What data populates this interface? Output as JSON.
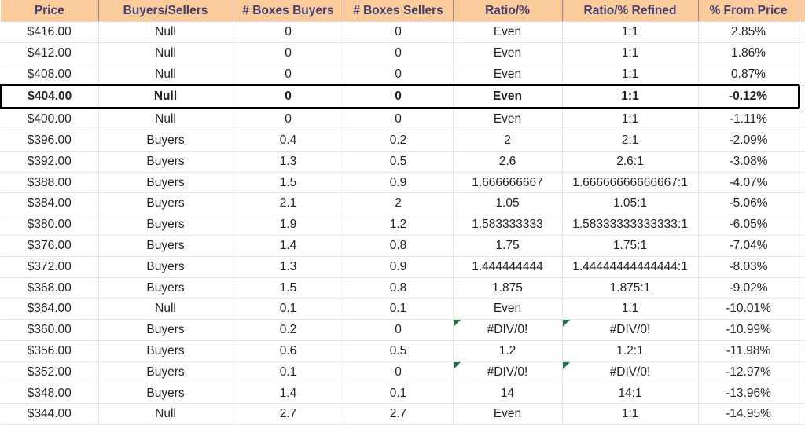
{
  "sheet": {
    "highlighted_row_index": 3,
    "colors": {
      "header_fill": "#FBCB9C",
      "header_text": "#403E6E",
      "null_fill": "#FCE79C",
      "null_text": "#9C6500",
      "buyers_fill": "#C6EFCE",
      "buyers_text": "#1D7A32",
      "grid_line": "#E4E4E4",
      "highlight_border": "#000000",
      "error_flag": "#217346"
    },
    "columns": [
      "Price",
      "Buyers/Sellers",
      "# Boxes Buyers",
      "# Boxes Sellers",
      "Ratio/%",
      "Ratio/% Refined",
      "% From Price"
    ],
    "rows": [
      {
        "price": "$416.00",
        "buyers_sellers": "Null",
        "fill": "null",
        "boxes_buyers": "0",
        "boxes_sellers": "0",
        "ratio": "Even",
        "ratio_refined": "1:1",
        "pct_from_price": "2.85%",
        "ratio_error": false,
        "ratio_refined_error": false
      },
      {
        "price": "$412.00",
        "buyers_sellers": "Null",
        "fill": "null",
        "boxes_buyers": "0",
        "boxes_sellers": "0",
        "ratio": "Even",
        "ratio_refined": "1:1",
        "pct_from_price": "1.86%",
        "ratio_error": false,
        "ratio_refined_error": false
      },
      {
        "price": "$408.00",
        "buyers_sellers": "Null",
        "fill": "null",
        "boxes_buyers": "0",
        "boxes_sellers": "0",
        "ratio": "Even",
        "ratio_refined": "1:1",
        "pct_from_price": "0.87%",
        "ratio_error": false,
        "ratio_refined_error": false
      },
      {
        "price": "$404.00",
        "buyers_sellers": "Null",
        "fill": "null",
        "boxes_buyers": "0",
        "boxes_sellers": "0",
        "ratio": "Even",
        "ratio_refined": "1:1",
        "pct_from_price": "-0.12%",
        "ratio_error": false,
        "ratio_refined_error": false
      },
      {
        "price": "$400.00",
        "buyers_sellers": "Null",
        "fill": "null",
        "boxes_buyers": "0",
        "boxes_sellers": "0",
        "ratio": "Even",
        "ratio_refined": "1:1",
        "pct_from_price": "-1.11%",
        "ratio_error": false,
        "ratio_refined_error": false
      },
      {
        "price": "$396.00",
        "buyers_sellers": "Buyers",
        "fill": "buyers",
        "boxes_buyers": "0.4",
        "boxes_sellers": "0.2",
        "ratio": "2",
        "ratio_refined": "2:1",
        "pct_from_price": "-2.09%",
        "ratio_error": false,
        "ratio_refined_error": false
      },
      {
        "price": "$392.00",
        "buyers_sellers": "Buyers",
        "fill": "buyers",
        "boxes_buyers": "1.3",
        "boxes_sellers": "0.5",
        "ratio": "2.6",
        "ratio_refined": "2.6:1",
        "pct_from_price": "-3.08%",
        "ratio_error": false,
        "ratio_refined_error": false
      },
      {
        "price": "$388.00",
        "buyers_sellers": "Buyers",
        "fill": "buyers",
        "boxes_buyers": "1.5",
        "boxes_sellers": "0.9",
        "ratio": "1.666666667",
        "ratio_refined": "1.66666666666667:1",
        "pct_from_price": "-4.07%",
        "ratio_error": false,
        "ratio_refined_error": false
      },
      {
        "price": "$384.00",
        "buyers_sellers": "Buyers",
        "fill": "buyers",
        "boxes_buyers": "2.1",
        "boxes_sellers": "2",
        "ratio": "1.05",
        "ratio_refined": "1.05:1",
        "pct_from_price": "-5.06%",
        "ratio_error": false,
        "ratio_refined_error": false
      },
      {
        "price": "$380.00",
        "buyers_sellers": "Buyers",
        "fill": "buyers",
        "boxes_buyers": "1.9",
        "boxes_sellers": "1.2",
        "ratio": "1.583333333",
        "ratio_refined": "1.58333333333333:1",
        "pct_from_price": "-6.05%",
        "ratio_error": false,
        "ratio_refined_error": false
      },
      {
        "price": "$376.00",
        "buyers_sellers": "Buyers",
        "fill": "buyers",
        "boxes_buyers": "1.4",
        "boxes_sellers": "0.8",
        "ratio": "1.75",
        "ratio_refined": "1.75:1",
        "pct_from_price": "-7.04%",
        "ratio_error": false,
        "ratio_refined_error": false
      },
      {
        "price": "$372.00",
        "buyers_sellers": "Buyers",
        "fill": "buyers",
        "boxes_buyers": "1.3",
        "boxes_sellers": "0.9",
        "ratio": "1.444444444",
        "ratio_refined": "1.44444444444444:1",
        "pct_from_price": "-8.03%",
        "ratio_error": false,
        "ratio_refined_error": false
      },
      {
        "price": "$368.00",
        "buyers_sellers": "Buyers",
        "fill": "buyers",
        "boxes_buyers": "1.5",
        "boxes_sellers": "0.8",
        "ratio": "1.875",
        "ratio_refined": "1.875:1",
        "pct_from_price": "-9.02%",
        "ratio_error": false,
        "ratio_refined_error": false
      },
      {
        "price": "$364.00",
        "buyers_sellers": "Null",
        "fill": "null",
        "boxes_buyers": "0.1",
        "boxes_sellers": "0.1",
        "ratio": "Even",
        "ratio_refined": "1:1",
        "pct_from_price": "-10.01%",
        "ratio_error": false,
        "ratio_refined_error": false
      },
      {
        "price": "$360.00",
        "buyers_sellers": "Buyers",
        "fill": "buyers",
        "boxes_buyers": "0.2",
        "boxes_sellers": "0",
        "ratio": "#DIV/0!",
        "ratio_refined": "#DIV/0!",
        "pct_from_price": "-10.99%",
        "ratio_error": true,
        "ratio_refined_error": true
      },
      {
        "price": "$356.00",
        "buyers_sellers": "Buyers",
        "fill": "buyers",
        "boxes_buyers": "0.6",
        "boxes_sellers": "0.5",
        "ratio": "1.2",
        "ratio_refined": "1.2:1",
        "pct_from_price": "-11.98%",
        "ratio_error": false,
        "ratio_refined_error": false
      },
      {
        "price": "$352.00",
        "buyers_sellers": "Buyers",
        "fill": "buyers",
        "boxes_buyers": "0.1",
        "boxes_sellers": "0",
        "ratio": "#DIV/0!",
        "ratio_refined": "#DIV/0!",
        "pct_from_price": "-12.97%",
        "ratio_error": true,
        "ratio_refined_error": true
      },
      {
        "price": "$348.00",
        "buyers_sellers": "Buyers",
        "fill": "buyers",
        "boxes_buyers": "1.4",
        "boxes_sellers": "0.1",
        "ratio": "14",
        "ratio_refined": "14:1",
        "pct_from_price": "-13.96%",
        "ratio_error": false,
        "ratio_refined_error": false
      },
      {
        "price": "$344.00",
        "buyers_sellers": "Null",
        "fill": "null",
        "boxes_buyers": "2.7",
        "boxes_sellers": "2.7",
        "ratio": "Even",
        "ratio_refined": "1:1",
        "pct_from_price": "-14.95%",
        "ratio_error": false,
        "ratio_refined_error": false
      }
    ]
  }
}
